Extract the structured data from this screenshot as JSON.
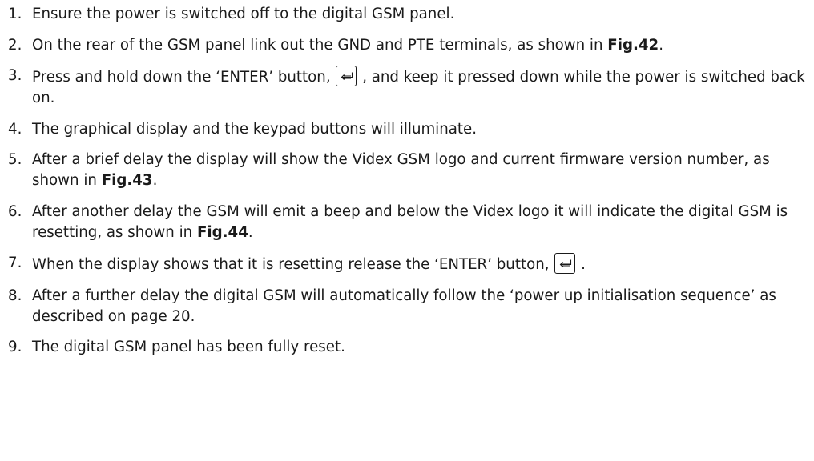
{
  "steps": [
    {
      "number": "1.",
      "parts": [
        {
          "t": "text",
          "v": "Ensure the power is switched off to the digital GSM panel."
        }
      ]
    },
    {
      "number": "2.",
      "parts": [
        {
          "t": "text",
          "v": "On the rear of the GSM panel link out the GND and PTE terminals, as shown in "
        },
        {
          "t": "bold",
          "v": "Fig.42"
        },
        {
          "t": "text",
          "v": "."
        }
      ]
    },
    {
      "number": "3.",
      "parts": [
        {
          "t": "text",
          "v": "Press and hold down the ‘ENTER’ button, "
        },
        {
          "t": "icon",
          "v": "enter-key-icon"
        },
        {
          "t": "text",
          "v": " , and keep it pressed down while the power is switched back on."
        }
      ]
    },
    {
      "number": "4.",
      "parts": [
        {
          "t": "text",
          "v": "The graphical display and the keypad buttons will illuminate."
        }
      ]
    },
    {
      "number": "5.",
      "parts": [
        {
          "t": "text",
          "v": "After a brief delay the display will show the Videx GSM logo and current firmware version number, as shown in "
        },
        {
          "t": "bold",
          "v": "Fig.43"
        },
        {
          "t": "text",
          "v": "."
        }
      ]
    },
    {
      "number": "6.",
      "parts": [
        {
          "t": "text",
          "v": "After another delay the GSM will emit a beep and below the Videx logo it will indicate the digital GSM is resetting, as shown in "
        },
        {
          "t": "bold",
          "v": "Fig.44"
        },
        {
          "t": "text",
          "v": "."
        }
      ]
    },
    {
      "number": "7.",
      "parts": [
        {
          "t": "text",
          "v": "When the display shows that it is resetting release the ‘ENTER’ button, "
        },
        {
          "t": "icon",
          "v": "enter-key-icon"
        },
        {
          "t": "text",
          "v": " ."
        }
      ]
    },
    {
      "number": "8.",
      "parts": [
        {
          "t": "text",
          "v": "After a further delay the digital GSM will automatically follow the ‘power up initialisation sequence’ as described on page 20."
        }
      ]
    },
    {
      "number": "9.",
      "parts": [
        {
          "t": "text",
          "v": "The digital GSM panel has been fully reset."
        }
      ]
    }
  ]
}
